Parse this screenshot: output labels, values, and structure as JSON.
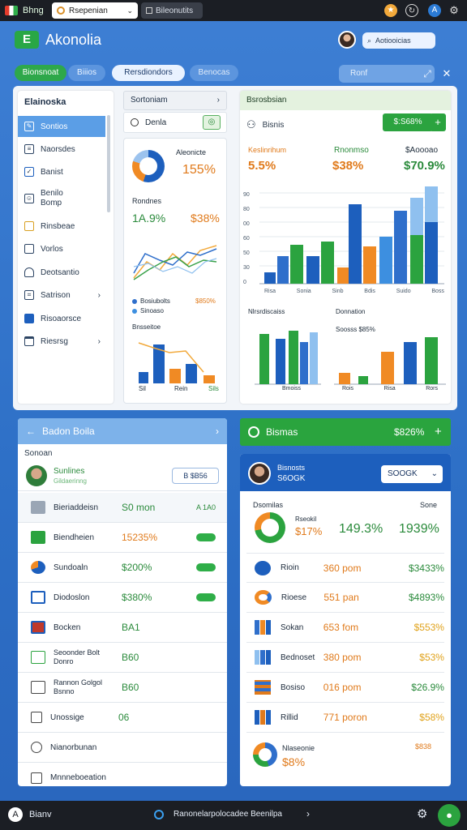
{
  "system_bar": {
    "brand": "Bhng",
    "tab_active": "Rsepenian",
    "tab_inactive": "Bileonutits"
  },
  "header": {
    "app_name": "Akonolia",
    "search_placeholder": "Aotiooicias"
  },
  "nav": {
    "pills": [
      "Bionsnoat",
      "Biiios",
      "Rersdiondors",
      "Benocas"
    ],
    "filter_label": "Ronf"
  },
  "sidebar": {
    "title": "Elainoska",
    "items": [
      {
        "label": "Sontios"
      },
      {
        "label": "Naorsdes"
      },
      {
        "label": "Banist"
      },
      {
        "label": "Benilo\nBomp"
      },
      {
        "label": "Rinsbeae"
      },
      {
        "label": "Vorlos"
      },
      {
        "label": "Deotsantio"
      },
      {
        "label": "Satrison"
      },
      {
        "label": "Risoaorsce"
      },
      {
        "label": "Riesrsg"
      }
    ]
  },
  "middle": {
    "dropdown": "Sortoniam",
    "toggle_label": "Denla",
    "donut_label": "Aleonicte",
    "donut_value": "155%",
    "section_label": "Rondnes",
    "kpi_left": "1A.9%",
    "kpi_right": "$38%",
    "line_legend": [
      {
        "label": "Bosiubolts",
        "value": "$850%",
        "color": "#2f6fcb"
      },
      {
        "label": "Sinoaso",
        "value": "",
        "color": "#3d8fe0"
      }
    ],
    "mini_label": "Bnsseitoe",
    "mini_bar_labels": [
      "Sil",
      "Rein",
      "Sils"
    ]
  },
  "big_chart": {
    "header": "Bsrosbsian",
    "sub_label": "Bisnis",
    "button_label": "$:S68%",
    "kpis": [
      {
        "label": "Keslinrihum",
        "value": "5.5%",
        "color": "#e07a1b"
      },
      {
        "label": "Rnonmso",
        "value": "$38%",
        "color": "#e07a1b",
        "label_color": "#2a8a3b"
      },
      {
        "label": "$Aoooao",
        "value": "$70.9%",
        "color": "#2a8a3b"
      }
    ],
    "chart_data": {
      "type": "bar",
      "categories": [
        "Risa",
        "Sonia",
        "Sinb",
        "Bdis",
        "Suido",
        "Boss"
      ],
      "yticks": [
        "90",
        "80",
        "00",
        "60",
        "50",
        "30",
        "0"
      ]
    },
    "sub1_title": "Nlrsrdiscaiss",
    "sub1_xlabel": "Bmoiss",
    "sub2_title": "Donnation",
    "sub2_values": "Soosss $85%",
    "sub2_labels": [
      "Rois",
      "Risa",
      "Rors"
    ]
  },
  "bottom_left": {
    "header": "Badon Boila",
    "sub_label": "Sonoan",
    "profile_name": "Sunlines",
    "profile_sub": "Gildaerinng",
    "profile_button": "B $B56",
    "rows": [
      {
        "label": "Bieriaddeisn",
        "value": "S0 mon",
        "value_color": "#2a8a3b",
        "right": "A 1A0"
      },
      {
        "label": "Biendheien",
        "value": "15235%",
        "value_color": "#e07a1b"
      },
      {
        "label": "Sundoaln",
        "value": "$200%",
        "value_color": "#2a8a3b"
      },
      {
        "label": "Diodoslon",
        "value": "$380%",
        "value_color": "#2a8a3b"
      },
      {
        "label": "Bocken",
        "value": "BA1",
        "value_color": "#2a8a3b"
      },
      {
        "label": "Seoonder Bolt\nDonro",
        "value": "B60",
        "value_color": "#2a8a3b"
      },
      {
        "label": "Rannon Golgol\nBsnno",
        "value": "B60",
        "value_color": "#2a8a3b"
      },
      {
        "label": "Unossige",
        "value": "06",
        "value_color": "#2a8a3b"
      },
      {
        "label": "Nianorbunan",
        "value": "",
        "value_color": "#2a8a3b"
      },
      {
        "label": "Mnnneboeation",
        "value": "",
        "value_color": "#2a8a3b"
      }
    ]
  },
  "bottom_right": {
    "green_bar_label": "Bismas",
    "green_bar_value": "$826%",
    "head_name": "Bisnosts",
    "head_sub": "S6OGK",
    "select_value": "SOOGK",
    "summary_left_label": "Dsomilas",
    "summary_right_label": "Sone",
    "donut_mini_label": "Rseokil",
    "donut_value": "$17%",
    "summary_mid": "149.3%",
    "summary_right": "1939%",
    "rows": [
      {
        "label": "Rioin",
        "v1": "360 pom",
        "v2": "$3433%"
      },
      {
        "label": "Rioese",
        "v1": "551 pan",
        "v2": "$4893%"
      },
      {
        "label": "Sokan",
        "v1": "653 fom",
        "v2": "$553%"
      },
      {
        "label": "Bednoset",
        "v1": "380 pom",
        "v2": "$53%"
      },
      {
        "label": "Bosiso",
        "v1": "016 pom",
        "v2": "$26.9%"
      },
      {
        "label": "Rillid",
        "v1": "771 poron",
        "v2": "$58%"
      }
    ],
    "foot_label": "Nlaseonie",
    "foot_value": "$8%",
    "foot_right": "$838"
  },
  "footer": {
    "left": "Bianv",
    "center": "Ranonelarpolocadee Beenilpa"
  },
  "colors": {
    "accent": "#2d6fc6",
    "green": "#2ba33f",
    "orange": "#e07a1b"
  }
}
